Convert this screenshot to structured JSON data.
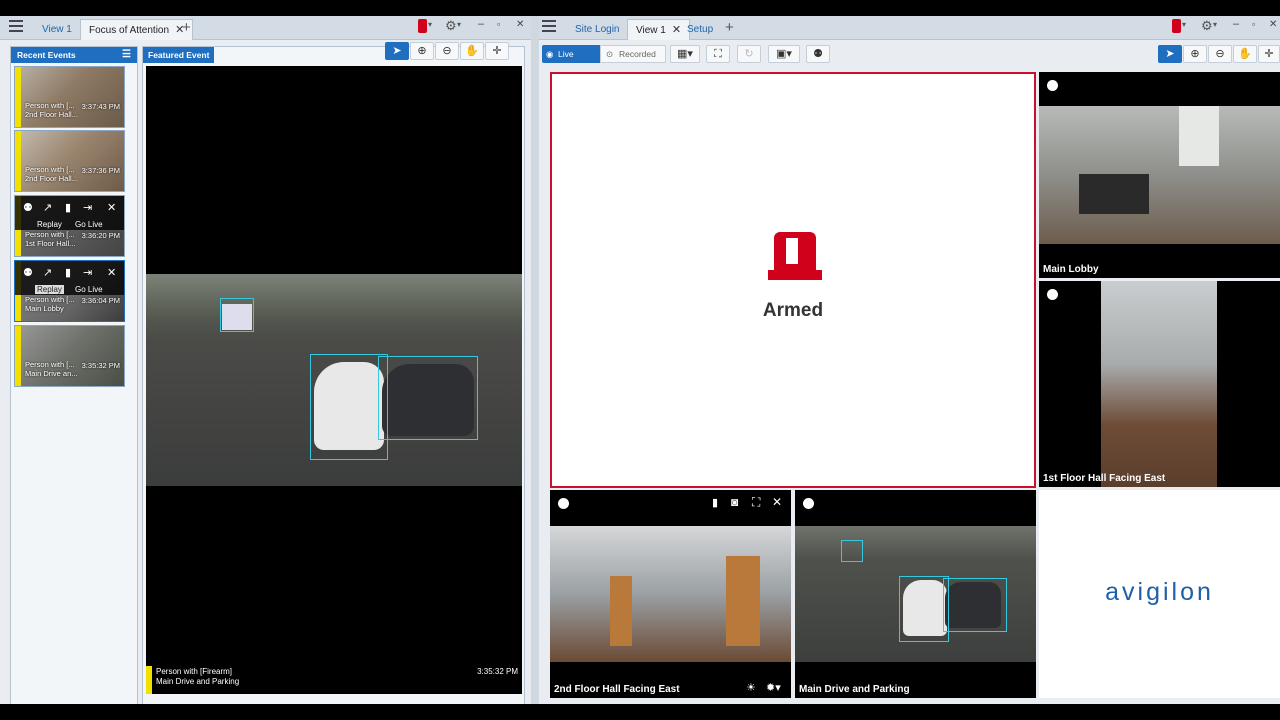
{
  "left_window": {
    "tabs": [
      {
        "label": "View 1"
      },
      {
        "label": "Focus of Attention"
      }
    ],
    "recent_events_title": "Recent Events",
    "featured_title": "Featured Event",
    "events": [
      {
        "label": "Person with [...",
        "time": "3:37:43 PM",
        "location": "2nd Floor Hall..."
      },
      {
        "label": "Person with [...",
        "time": "3:37:36 PM",
        "location": "2nd Floor Hall..."
      },
      {
        "label": "Person with [...",
        "time": "3:36:20 PM",
        "location": "1st Floor Hall..."
      },
      {
        "label": "Person with [...",
        "time": "3:36:04 PM",
        "location": "Main Lobby"
      },
      {
        "label": "Person with [...",
        "time": "3:35:32 PM",
        "location": "Main Drive an..."
      }
    ],
    "event_actions": {
      "replay": "Replay",
      "go_live": "Go Live"
    },
    "featured_event": {
      "label": "Person with [Firearm]",
      "location": "Main Drive and Parking",
      "time": "3:35:32 PM"
    }
  },
  "right_window": {
    "tabs": [
      {
        "label": "Site Login"
      },
      {
        "label": "View 1"
      },
      {
        "label": "Setup"
      }
    ],
    "live_label": "Live",
    "recorded_label": "Recorded",
    "armed_label": "Armed",
    "brand": "avigilon",
    "cameras": [
      {
        "label": "Main Lobby"
      },
      {
        "label": "1st Floor Hall Facing East"
      },
      {
        "label": "2nd Floor Hall Facing East"
      },
      {
        "label": "Main Drive and Parking"
      }
    ]
  },
  "colors": {
    "accent": "#1f6ec0",
    "alarm": "#d0021b",
    "event_bar": "#f2e000",
    "box": "#35c9e0"
  }
}
